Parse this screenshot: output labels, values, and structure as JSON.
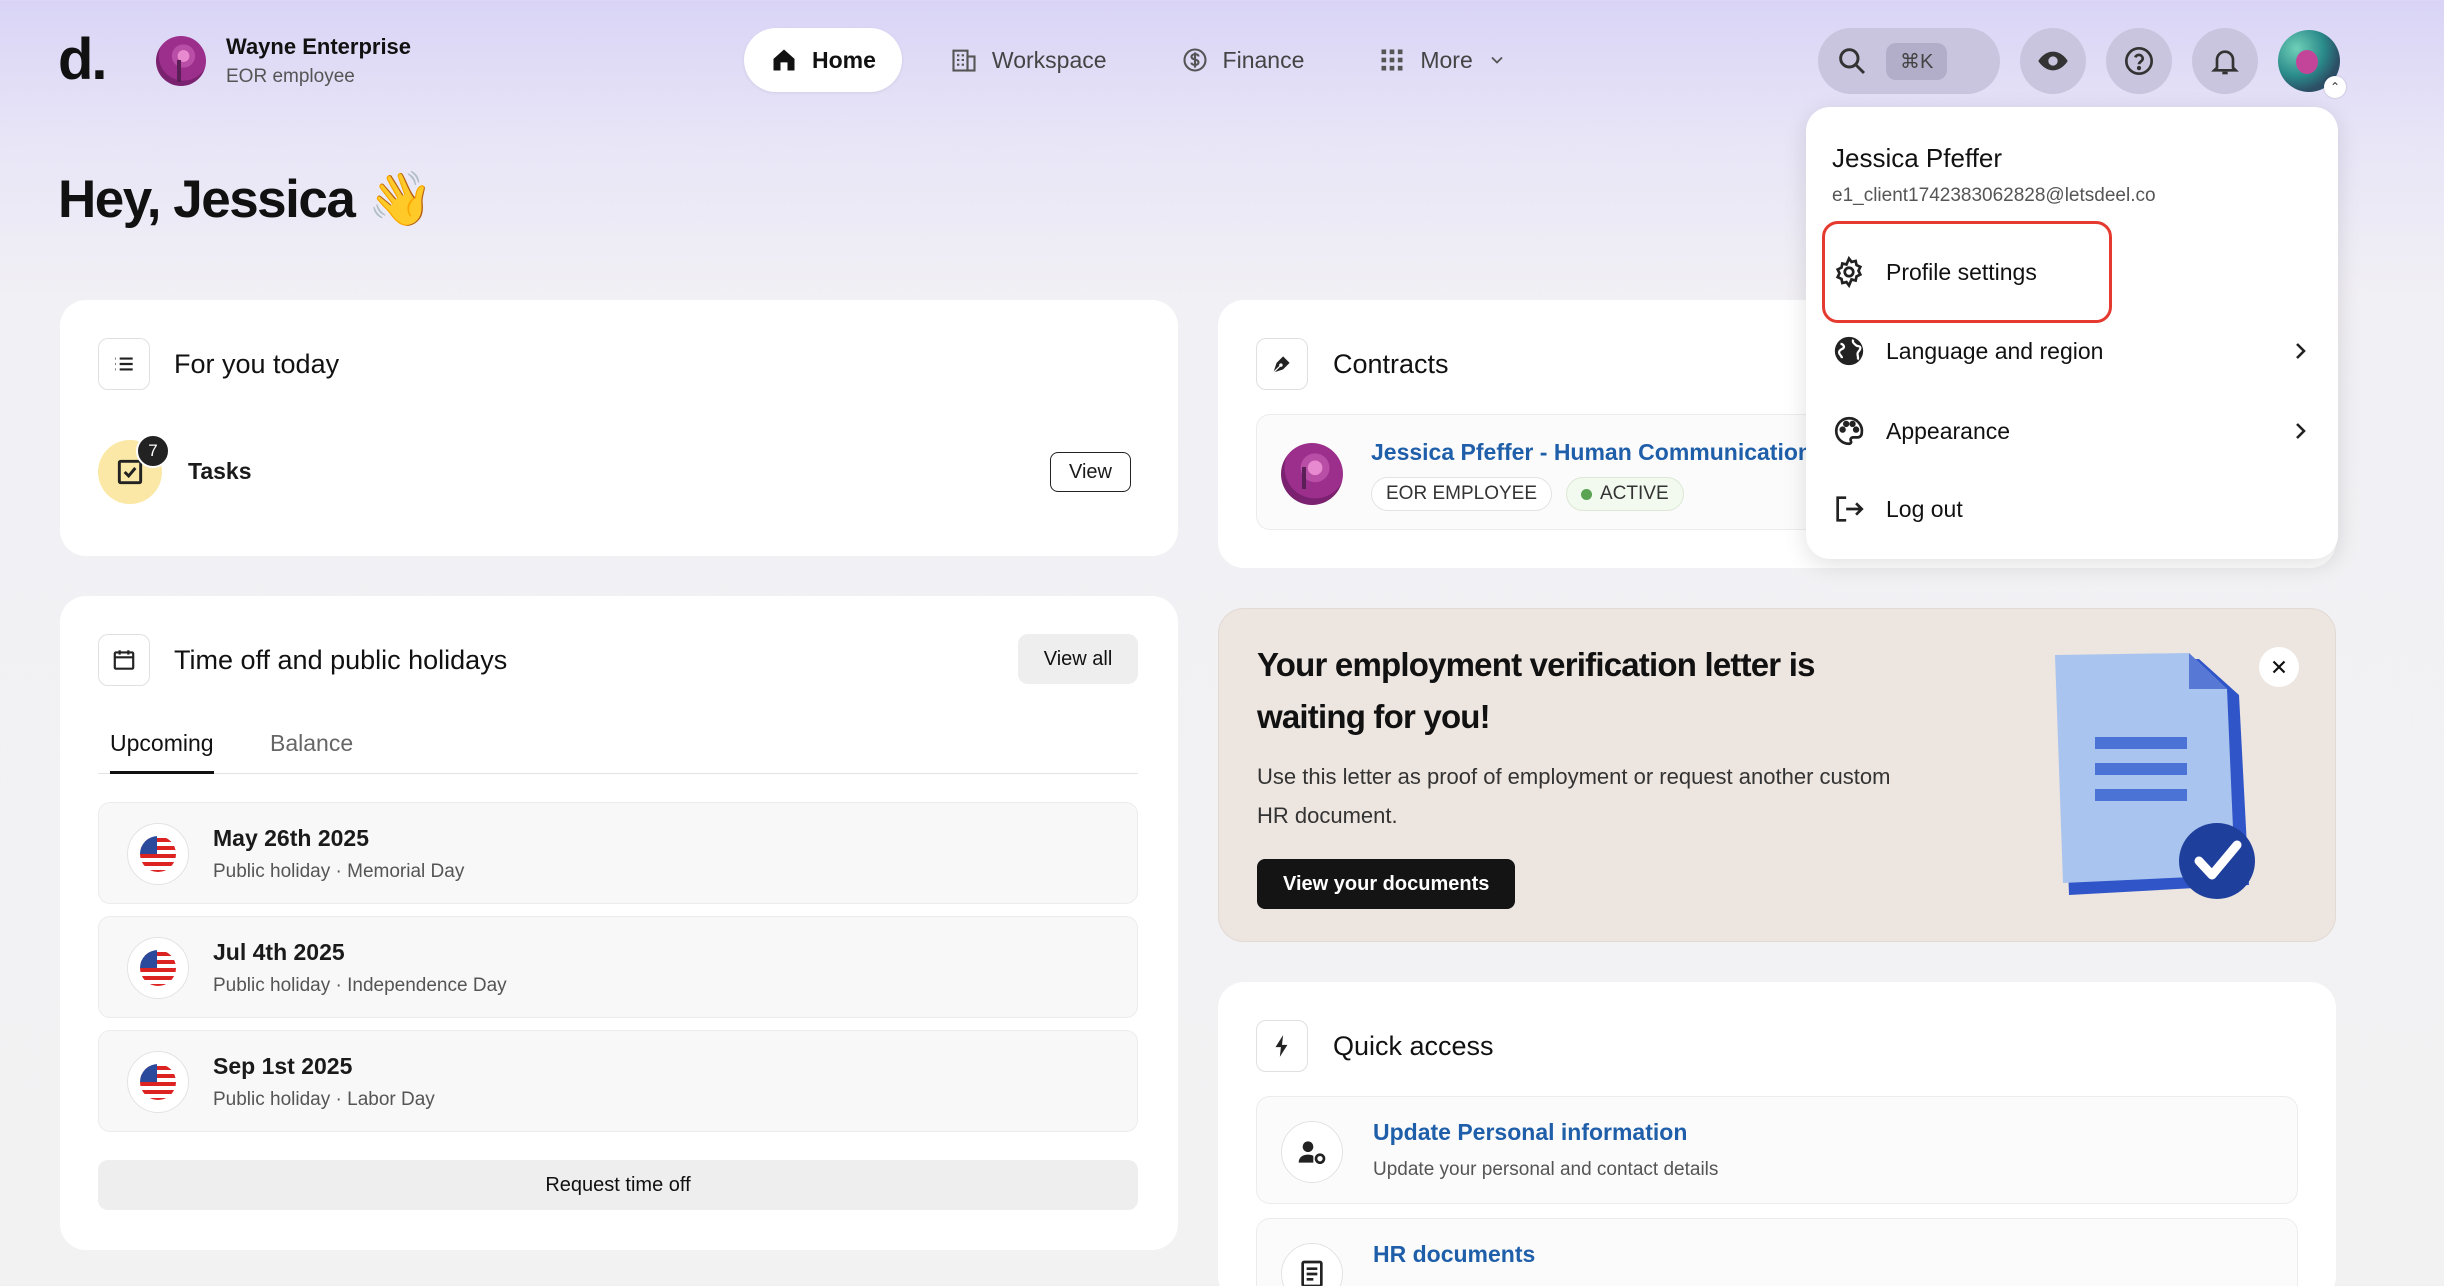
{
  "header": {
    "logo": "d.",
    "org_name": "Wayne Enterprise",
    "org_role": "EOR employee",
    "nav": [
      {
        "label": "Home",
        "icon": "home-icon",
        "active": true
      },
      {
        "label": "Workspace",
        "icon": "building-icon"
      },
      {
        "label": "Finance",
        "icon": "dollar-icon"
      },
      {
        "label": "More",
        "icon": "grid-icon"
      }
    ],
    "search_shortcut": "⌘K"
  },
  "greeting": "Hey, Jessica 👋",
  "for_you": {
    "title": "For you today",
    "tasks_label": "Tasks",
    "tasks_count": "7",
    "view_label": "View"
  },
  "time_off": {
    "title": "Time off and public holidays",
    "view_all": "View all",
    "tabs": [
      "Upcoming",
      "Balance"
    ],
    "holidays": [
      {
        "date": "May 26th 2025",
        "sub": "Public holiday · Memorial Day"
      },
      {
        "date": "Jul 4th 2025",
        "sub": "Public holiday · Independence Day"
      },
      {
        "date": "Sep 1st 2025",
        "sub": "Public holiday · Labor Day"
      }
    ],
    "request_button": "Request time off"
  },
  "contracts": {
    "title": "Contracts",
    "contract_name": "Jessica Pfeffer - Human Communication",
    "badge_type": "EOR EMPLOYEE",
    "badge_status": "ACTIVE"
  },
  "banner": {
    "title": "Your employment verification letter is waiting for you!",
    "body": "Use this letter as proof of employment or request another custom HR document.",
    "button": "View your documents"
  },
  "quick_access": {
    "title": "Quick access",
    "items": [
      {
        "title": "Update Personal information",
        "sub": "Update your personal and contact details"
      },
      {
        "title": "HR documents",
        "sub": ""
      }
    ]
  },
  "dropdown": {
    "name": "Jessica Pfeffer",
    "email": "e1_client1742383062828@letsdeel.co",
    "items": [
      {
        "label": "Profile settings",
        "icon": "gear-icon"
      },
      {
        "label": "Language and region",
        "icon": "globe-icon"
      },
      {
        "label": "Appearance",
        "icon": "palette-icon"
      },
      {
        "label": "Log out",
        "icon": "logout-icon"
      }
    ]
  },
  "colors": {
    "accent_blue": "#1f5faa",
    "highlight_red": "#e53a2f",
    "active_green": "#5aa352"
  }
}
